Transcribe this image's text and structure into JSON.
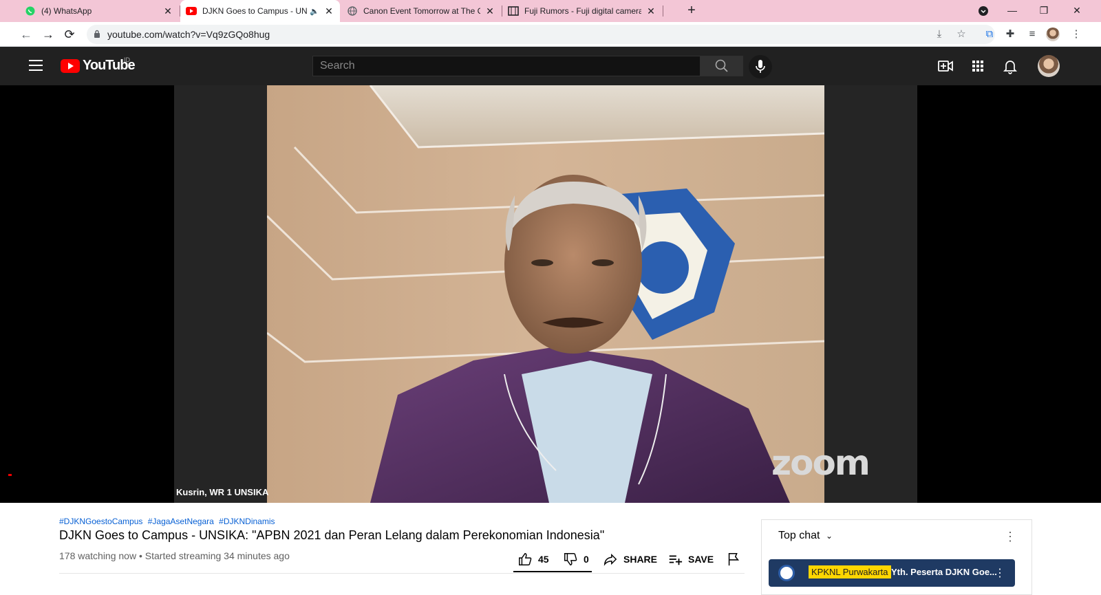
{
  "browser": {
    "tabs": [
      {
        "title": "(4) WhatsApp",
        "icon": "whatsapp-icon",
        "active": false
      },
      {
        "title": "DJKN Goes to Campus - UNS",
        "icon": "youtube-icon",
        "active": true
      },
      {
        "title": "Canon Event Tomorrow at The Ca",
        "icon": "globe-icon",
        "active": false
      },
      {
        "title": "Fuji Rumors - Fuji digital camera",
        "icon": "film-icon",
        "active": false
      }
    ],
    "url": "youtube.com/watch?v=Vq9zGQo8hug"
  },
  "youtube": {
    "logo_text": "YouTube",
    "country_code": "ID",
    "search_placeholder": "Search"
  },
  "player": {
    "speaker_label": "Kusrin, WR 1 UNSIKA",
    "watermark": "zoom"
  },
  "video": {
    "hashtags": [
      "#DJKNGoestoCampus",
      "#JagaAsetNegara",
      "#DJKNDinamis"
    ],
    "title": "DJKN Goes to Campus - UNSIKA: \"APBN 2021 dan Peran Lelang dalam Perekonomian Indonesia\"",
    "watching": "178 watching now",
    "started": "Started streaming 34 minutes ago",
    "likes": "45",
    "dislikes": "0",
    "share_label": "SHARE",
    "save_label": "SAVE"
  },
  "chat": {
    "header": "Top chat",
    "pinned_author": "KPKNL Purwakarta",
    "pinned_text": "Yth. Peserta DJKN Goe..."
  },
  "colors": {
    "tabbar": "#f3c6d6",
    "youtube_red": "#ff0000",
    "masthead": "#212121",
    "link": "#065fd4"
  }
}
